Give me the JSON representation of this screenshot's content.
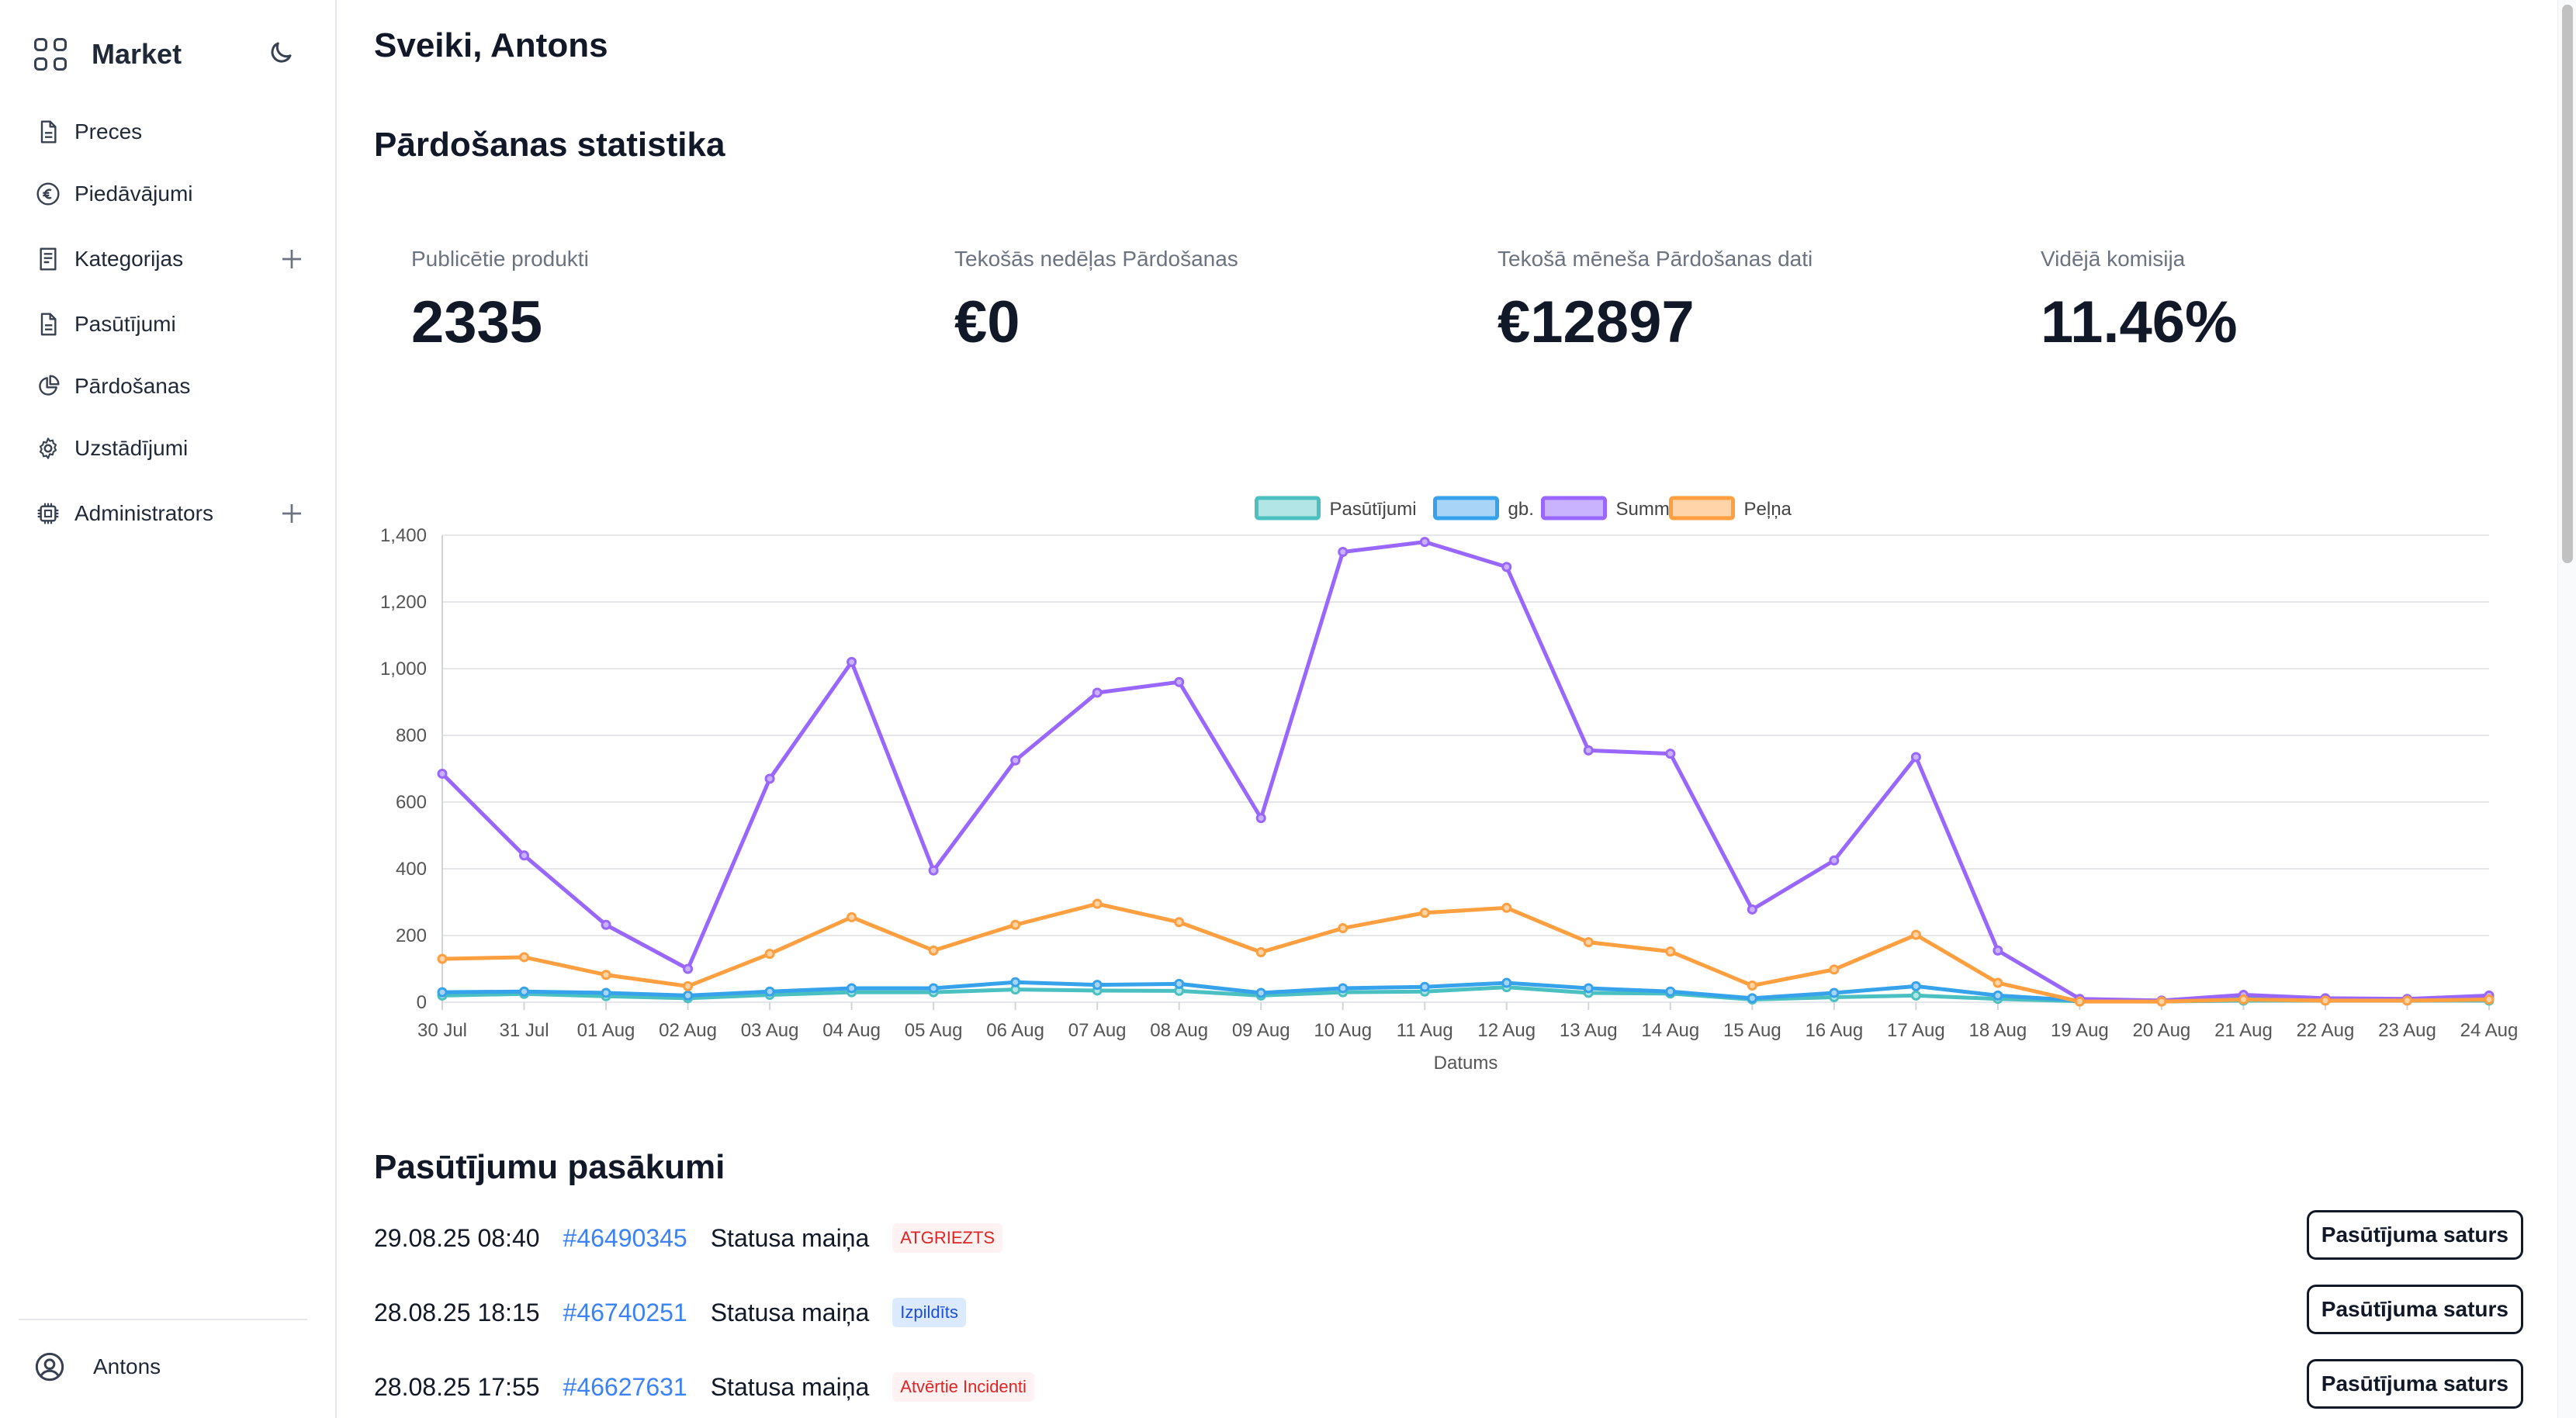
{
  "sidebar": {
    "brand": "Market",
    "items": [
      {
        "label": "Preces",
        "icon": "document-icon",
        "expandable": false
      },
      {
        "label": "Piedāvājumi",
        "icon": "euro-icon",
        "expandable": false
      },
      {
        "label": "Kategorijas",
        "icon": "document-lines-icon",
        "expandable": true
      },
      {
        "label": "Pasūtījumi",
        "icon": "document-icon",
        "expandable": false
      },
      {
        "label": "Pārdošanas",
        "icon": "pie-chart-icon",
        "expandable": false
      },
      {
        "label": "Uzstādījumi",
        "icon": "gear-icon",
        "expandable": false
      },
      {
        "label": "Administrators",
        "icon": "chip-icon",
        "expandable": true
      }
    ],
    "user": "Antons"
  },
  "main": {
    "greeting": "Sveiki, Antons",
    "stats_title": "Pārdošanas statistika",
    "stats": [
      {
        "label": "Publicētie produkti",
        "value": "2335"
      },
      {
        "label": "Tekošās nedēļas Pārdošanas",
        "value": "€0"
      },
      {
        "label": "Tekošā mēneša Pārdošanas dati",
        "value": "€12897"
      },
      {
        "label": "Vidējā komisija",
        "value": "11.46%"
      }
    ],
    "events_title": "Pasūtījumu pasākumi",
    "events": [
      {
        "datetime": "29.08.25 08:40",
        "order": "#46490345",
        "event": "Statusa maiņa",
        "status": "ATGRIEZTS",
        "status_bg": "#fef2f2",
        "status_color": "#dc2626",
        "button": "Pasūtījuma saturs"
      },
      {
        "datetime": "28.08.25 18:15",
        "order": "#46740251",
        "event": "Statusa maiņa",
        "status": "Izpildīts",
        "status_bg": "#dbeafe",
        "status_color": "#1d4ed8",
        "button": "Pasūtījuma saturs"
      },
      {
        "datetime": "28.08.25 17:55",
        "order": "#46627631",
        "event": "Statusa maiņa",
        "status": "Atvērtie Incidenti",
        "status_bg": "#fef2f2",
        "status_color": "#dc2626",
        "button": "Pasūtījuma saturs"
      }
    ]
  },
  "chart_data": {
    "type": "line",
    "xlabel": "Datums",
    "ylabel": "",
    "ylim": [
      0,
      1400
    ],
    "yticks": [
      0,
      200,
      400,
      600,
      800,
      1000,
      1200,
      1400
    ],
    "grid": true,
    "legend_position": "top-center",
    "categories": [
      "30 Jul",
      "31 Jul",
      "01 Aug",
      "02 Aug",
      "03 Aug",
      "04 Aug",
      "05 Aug",
      "06 Aug",
      "07 Aug",
      "08 Aug",
      "09 Aug",
      "10 Aug",
      "11 Aug",
      "12 Aug",
      "13 Aug",
      "14 Aug",
      "15 Aug",
      "16 Aug",
      "17 Aug",
      "18 Aug",
      "19 Aug",
      "20 Aug",
      "21 Aug",
      "22 Aug",
      "23 Aug",
      "24 Aug"
    ],
    "series": [
      {
        "name": "Pasūtījumi",
        "color": "#4bc0c0",
        "fill": "#b2e6e6",
        "values": [
          20,
          25,
          18,
          12,
          22,
          30,
          30,
          38,
          35,
          34,
          20,
          30,
          32,
          45,
          28,
          26,
          8,
          15,
          20,
          10,
          3,
          2,
          5,
          5,
          5,
          5
        ]
      },
      {
        "name": "gb.",
        "color": "#36a2eb",
        "fill": "#a8d5f7",
        "values": [
          30,
          32,
          28,
          20,
          32,
          42,
          42,
          60,
          52,
          55,
          28,
          42,
          46,
          58,
          42,
          32,
          12,
          28,
          48,
          20,
          5,
          3,
          12,
          8,
          8,
          12
        ]
      },
      {
        "name": "Summa",
        "color": "#9966ff",
        "fill": "#c9b3ff",
        "values": [
          685,
          440,
          232,
          100,
          670,
          1020,
          395,
          725,
          928,
          960,
          552,
          1350,
          1380,
          1305,
          755,
          745,
          278,
          425,
          735,
          155,
          10,
          5,
          22,
          12,
          10,
          20
        ]
      },
      {
        "name": "Peļņa",
        "color": "#ff9f40",
        "fill": "#ffd4a8",
        "values": [
          130,
          135,
          82,
          48,
          145,
          255,
          155,
          232,
          295,
          240,
          150,
          222,
          268,
          283,
          180,
          152,
          50,
          98,
          202,
          58,
          2,
          2,
          8,
          5,
          5,
          8
        ]
      }
    ]
  }
}
